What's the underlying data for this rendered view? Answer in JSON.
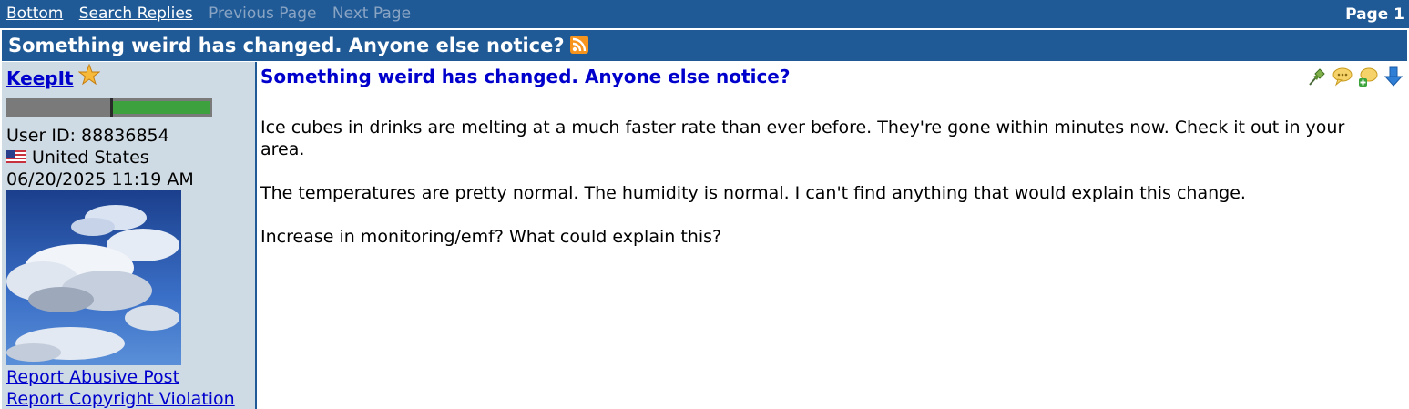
{
  "nav": {
    "bottom": "Bottom",
    "search_replies": "Search Replies",
    "previous_page": "Previous Page",
    "next_page": "Next Page",
    "page_indicator": "Page 1"
  },
  "thread": {
    "title": "Something weird has changed. Anyone else notice?"
  },
  "user": {
    "name": "KeepIt",
    "user_id": "User ID: 88836854",
    "country": "United States",
    "datetime": "06/20/2025 11:19 AM",
    "rank_fill_fraction": 0.48
  },
  "links": {
    "report_abusive": "Report Abusive Post",
    "report_copyright": "Report Copyright Violation"
  },
  "post": {
    "title": "Something weird has changed. Anyone else notice?",
    "paragraphs": [
      "Ice cubes in drinks are melting at a much faster rate than ever before. They're gone within minutes now. Check it out in your area.",
      "The temperatures are pretty normal. The humidity is normal. I can't find anything that would explain this change.",
      "Increase in monitoring/emf? What could explain this?"
    ]
  },
  "icons": [
    "rss-icon",
    "star-icon",
    "pin-icon",
    "quote-icon",
    "reply-icon",
    "down-arrow-icon"
  ],
  "colors": {
    "header_bg": "#1f5a96",
    "sidebar_bg": "#cfdbe4",
    "link": "#0000cc",
    "rank_green": "#3da13d"
  }
}
